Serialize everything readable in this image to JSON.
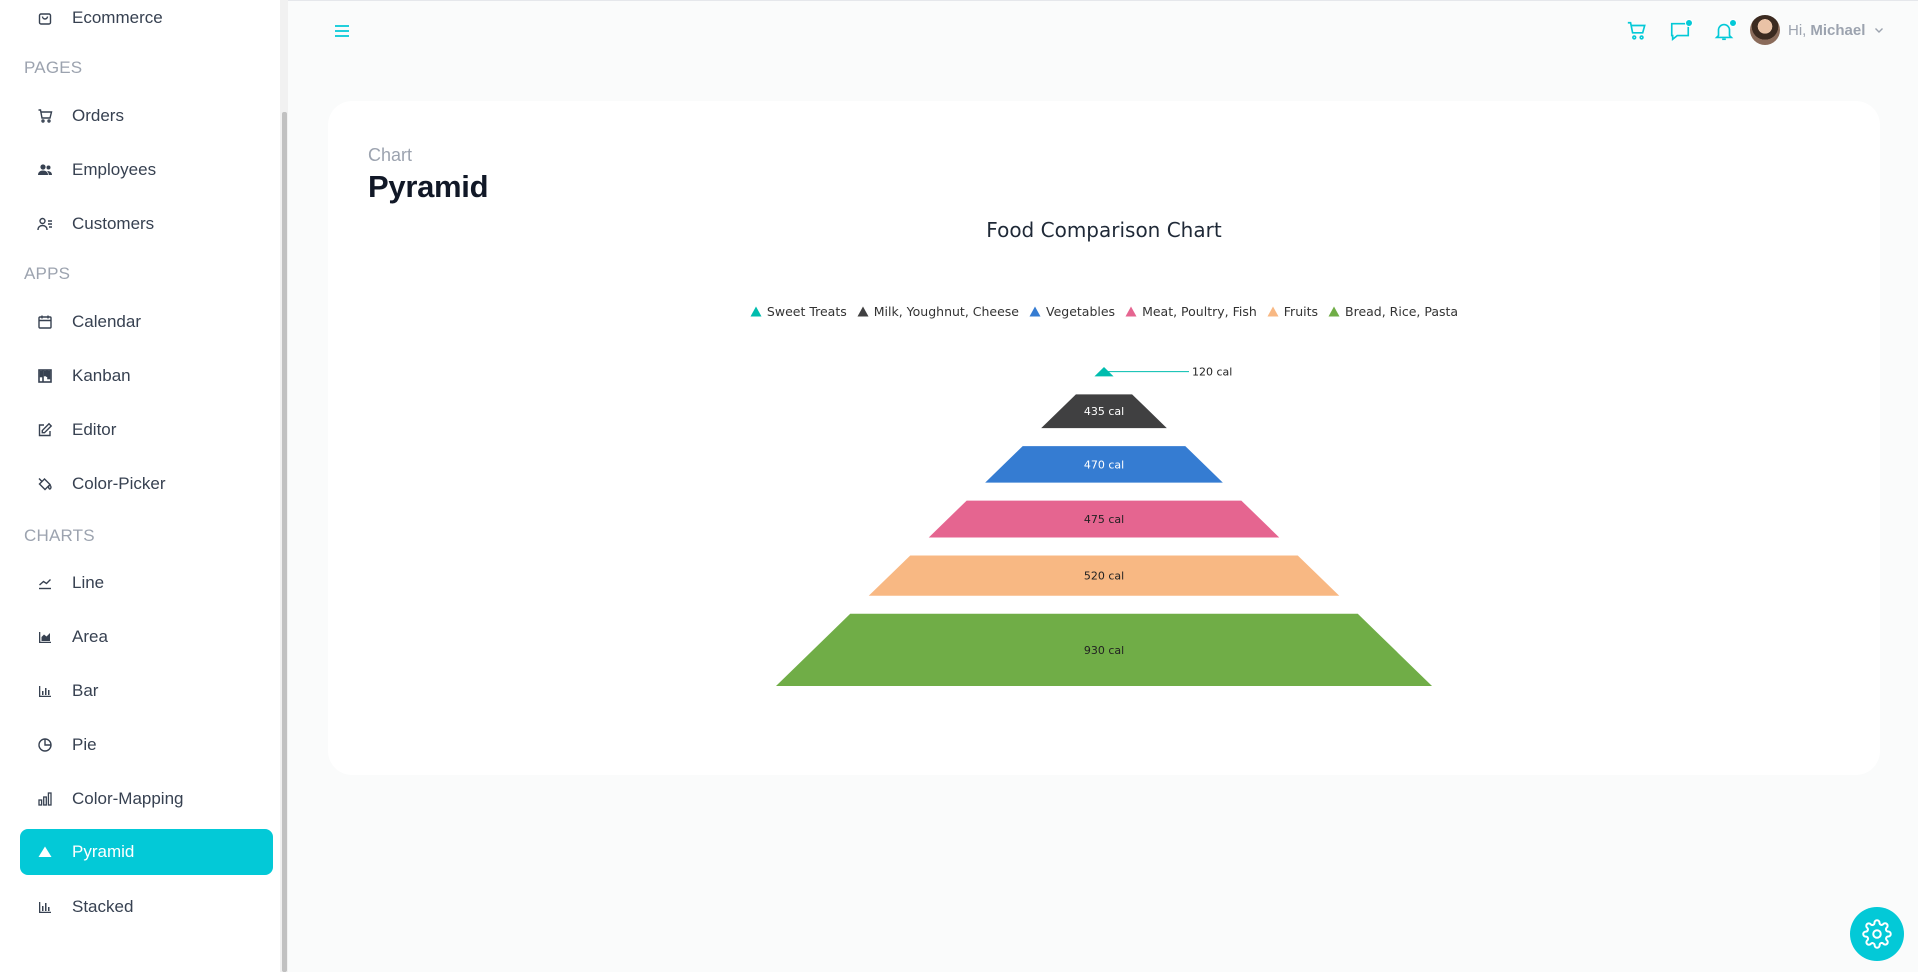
{
  "sidebar": {
    "items_top": [
      {
        "label": "Ecommerce",
        "icon": "shopping-bag-icon"
      }
    ],
    "sections": [
      {
        "title": "PAGES",
        "items": [
          {
            "label": "Orders",
            "icon": "cart-icon"
          },
          {
            "label": "Employees",
            "icon": "users-icon"
          },
          {
            "label": "Customers",
            "icon": "user-list-icon"
          }
        ]
      },
      {
        "title": "APPS",
        "items": [
          {
            "label": "Calendar",
            "icon": "calendar-icon"
          },
          {
            "label": "Kanban",
            "icon": "kanban-icon"
          },
          {
            "label": "Editor",
            "icon": "edit-icon"
          },
          {
            "label": "Color-Picker",
            "icon": "paint-bucket-icon"
          }
        ]
      },
      {
        "title": "CHARTS",
        "items": [
          {
            "label": "Line",
            "icon": "line-chart-icon"
          },
          {
            "label": "Area",
            "icon": "area-chart-icon"
          },
          {
            "label": "Bar",
            "icon": "bar-chart-icon"
          },
          {
            "label": "Pie",
            "icon": "pie-chart-icon"
          },
          {
            "label": "Color-Mapping",
            "icon": "color-mapping-icon"
          },
          {
            "label": "Pyramid",
            "icon": "pyramid-icon",
            "active": true
          },
          {
            "label": "Stacked",
            "icon": "stacked-chart-icon"
          }
        ]
      }
    ]
  },
  "header": {
    "greeting": "Hi,",
    "user_name": "Michael",
    "accent_color": "#03c9d7"
  },
  "main": {
    "breadcrumb": "Chart",
    "title": "Pyramid"
  },
  "chart_data": {
    "type": "pyramid",
    "title": "Food Comparison Chart",
    "legend_position": "top",
    "series": [
      {
        "name": "Sweet Treats",
        "value": 120,
        "label": "120 cal",
        "color": "#00bdae"
      },
      {
        "name": "Milk, Youghnut, Cheese",
        "value": 435,
        "label": "435 cal",
        "color": "#404041"
      },
      {
        "name": "Vegetables",
        "value": 470,
        "label": "470 cal",
        "color": "#357cd2"
      },
      {
        "name": "Meat, Poultry, Fish",
        "value": 475,
        "label": "475 cal",
        "color": "#e56590"
      },
      {
        "name": "Fruits",
        "value": 520,
        "label": "520 cal",
        "color": "#f8b883"
      },
      {
        "name": "Bread, Rice, Pasta",
        "value": 930,
        "label": "930 cal",
        "color": "#70ad47"
      }
    ]
  }
}
